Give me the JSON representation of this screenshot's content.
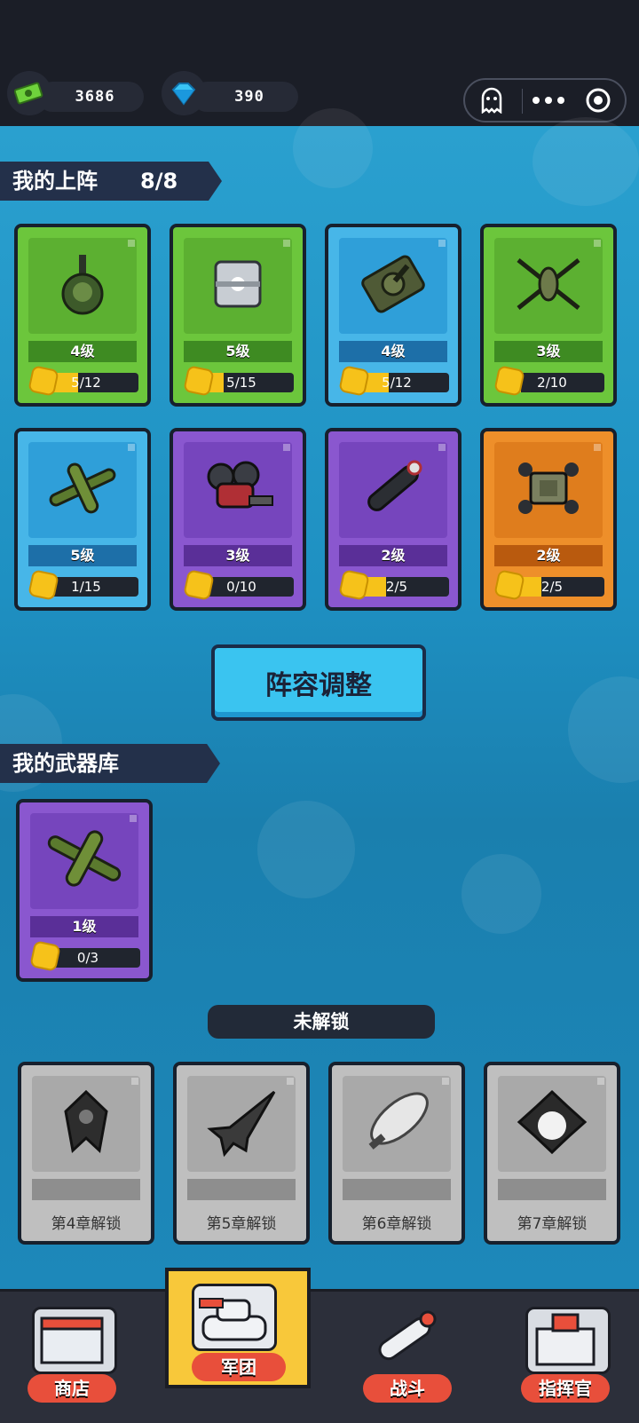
{
  "resources": {
    "cash": "3686",
    "gems": "390"
  },
  "lineup": {
    "title": "我的上阵",
    "count": "8/8",
    "cards": [
      {
        "level": "4级",
        "progress": "5/12",
        "fill": 0.42,
        "color": "green",
        "icon": "gun-turret"
      },
      {
        "level": "5级",
        "progress": "5/15",
        "fill": 0.33,
        "color": "green",
        "icon": "metal-cube"
      },
      {
        "level": "4级",
        "progress": "5/12",
        "fill": 0.42,
        "color": "blue",
        "icon": "tank"
      },
      {
        "level": "3级",
        "progress": "2/10",
        "fill": 0.2,
        "color": "green",
        "icon": "helicopter"
      },
      {
        "level": "5级",
        "progress": "1/15",
        "fill": 0.07,
        "color": "blue",
        "icon": "propeller-plane"
      },
      {
        "level": "3级",
        "progress": "0/10",
        "fill": 0.0,
        "color": "purple",
        "icon": "mech-robot"
      },
      {
        "level": "2级",
        "progress": "2/5",
        "fill": 0.4,
        "color": "purple",
        "icon": "missile"
      },
      {
        "level": "2级",
        "progress": "2/5",
        "fill": 0.4,
        "color": "orange",
        "icon": "drone-tank"
      }
    ],
    "adjust_button": "阵容调整"
  },
  "arsenal": {
    "title": "我的武器库",
    "cards": [
      {
        "level": "1级",
        "progress": "0/3",
        "fill": 0.0,
        "color": "purple",
        "icon": "propeller-plane"
      }
    ]
  },
  "locked": {
    "title": "未解锁",
    "cards": [
      {
        "unlock": "第4章解锁",
        "icon": "alien-mech"
      },
      {
        "unlock": "第5章解锁",
        "icon": "jet-fighter"
      },
      {
        "unlock": "第6章解锁",
        "icon": "airship"
      },
      {
        "unlock": "第7章解锁",
        "icon": "boss-ship"
      }
    ]
  },
  "nav": [
    {
      "label": "商店",
      "icon": "shop-icon"
    },
    {
      "label": "军团",
      "icon": "tank-icon"
    },
    {
      "label": "战斗",
      "icon": "rocket-icon"
    },
    {
      "label": "指挥官",
      "icon": "hq-icon"
    }
  ]
}
